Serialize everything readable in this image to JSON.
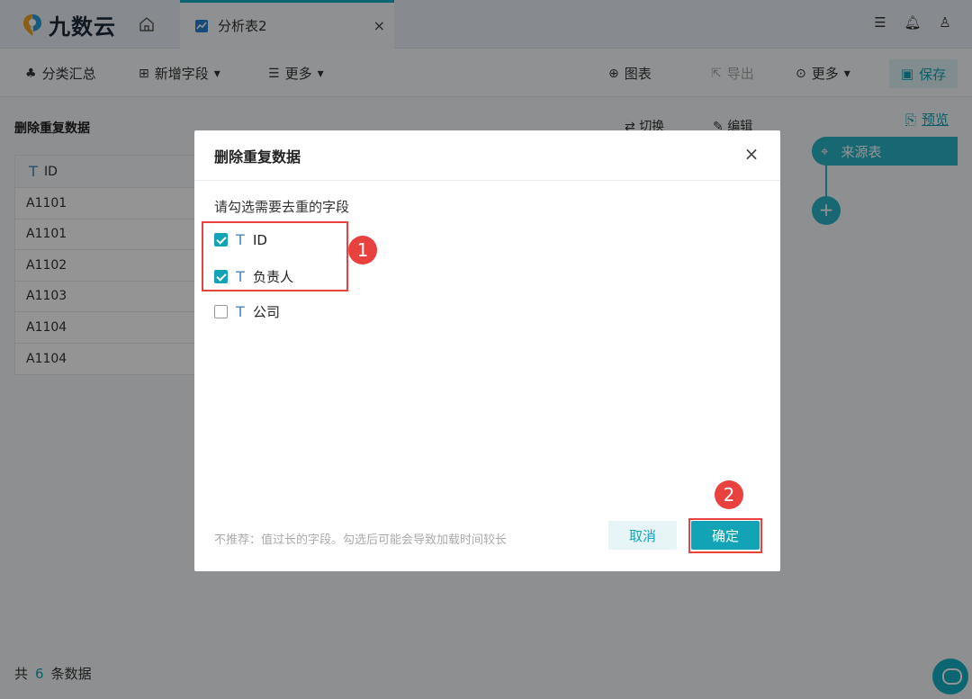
{
  "app": {
    "brand": "九数云"
  },
  "tab": {
    "label": "分析表2",
    "close": "×"
  },
  "toolbar": {
    "group_summary": "分类汇总",
    "add_field": "新增字段",
    "more_left": "更多",
    "chart": "图表",
    "export": "导出",
    "more_right": "更多",
    "save": "保存"
  },
  "left_panel": {
    "title": "删除重复数据",
    "column": "ID",
    "rows": [
      "A1101",
      "A1101",
      "A1102",
      "A1103",
      "A1104",
      "A1104"
    ],
    "footer_prefix": "共",
    "footer_count": "6",
    "footer_suffix": "条数据"
  },
  "mid_actions": {
    "switch": "切换",
    "edit": "编辑"
  },
  "preview": "预览",
  "flow": {
    "source_table": "来源表",
    "add": "+"
  },
  "modal": {
    "title": "删除重复数据",
    "close": "×",
    "hint": "请勾选需要去重的字段",
    "fields": [
      {
        "label": "ID",
        "checked": true
      },
      {
        "label": "负责人",
        "checked": true
      },
      {
        "label": "公司",
        "checked": false
      }
    ],
    "type_glyph": "T",
    "note": "不推荐：值过长的字段。勾选后可能会导致加载时间较长",
    "cancel": "取消",
    "confirm": "确定"
  },
  "annotations": {
    "one": "1",
    "two": "2"
  },
  "colors": {
    "accent": "#13a3b6",
    "annotation": "#e8413e"
  }
}
